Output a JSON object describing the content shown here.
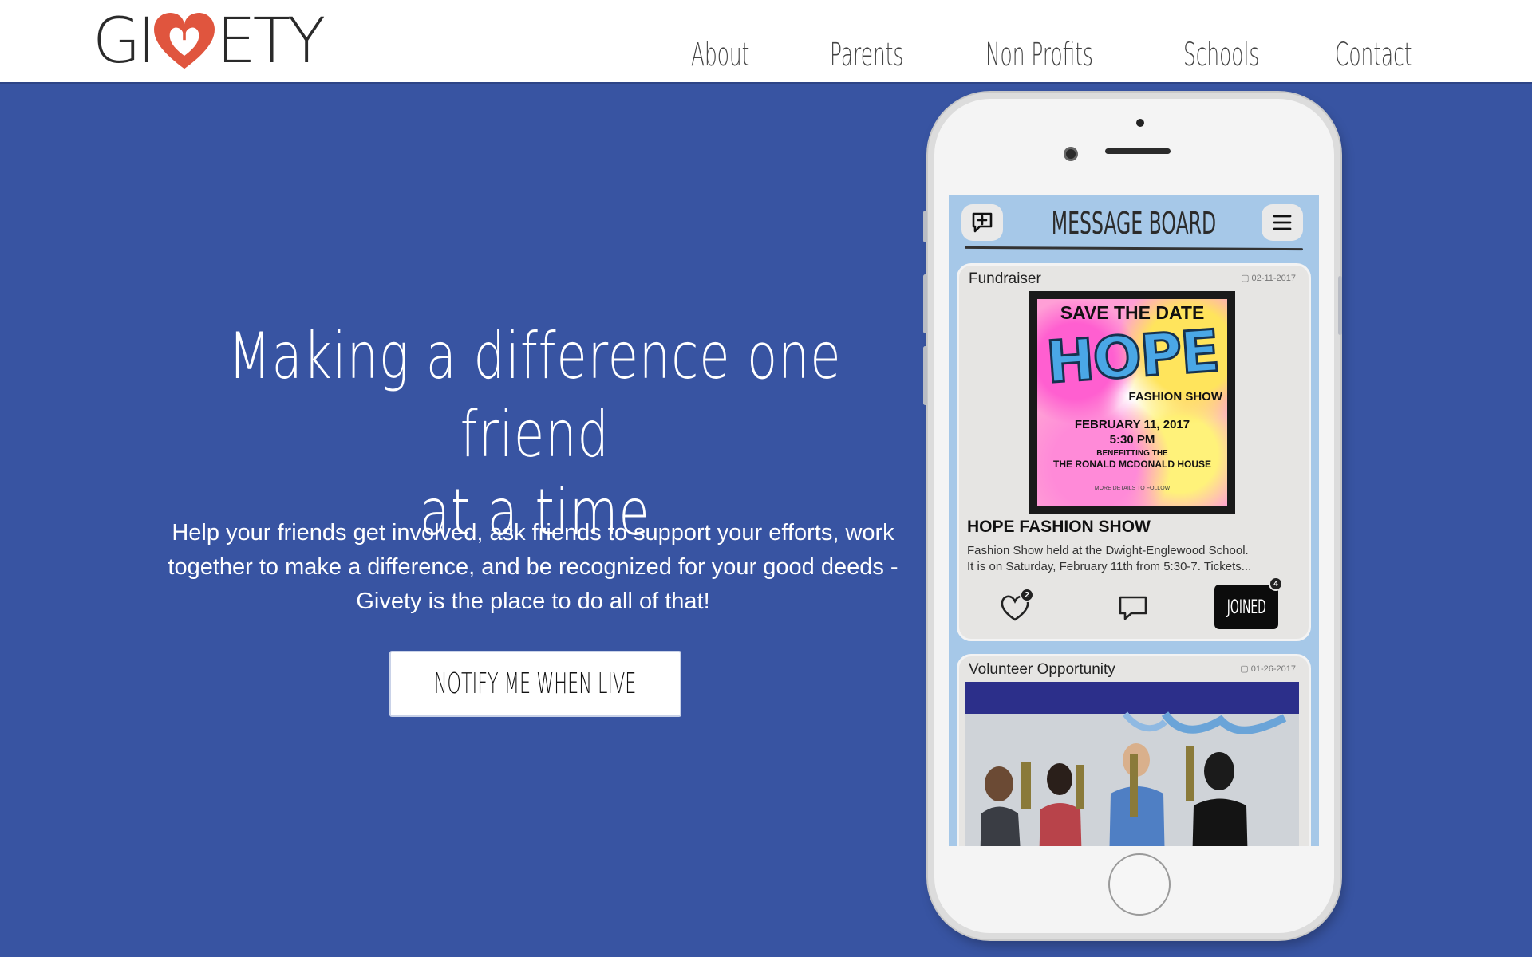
{
  "header": {
    "logo_left": "GI",
    "logo_right": "ETY",
    "nav": [
      "About",
      "Parents",
      "Non Profits",
      "Schools",
      "Contact"
    ]
  },
  "hero": {
    "title_line1": "Making a difference one friend",
    "title_line2": "at a time",
    "body_line1": "Help your friends get involved, ask friends to support your efforts, work",
    "body_line2": "together to make a difference, and be recognized for your good deeds -",
    "body_line3": "Givety is the place to do all of that!",
    "cta_label": "NOTIFY ME WHEN LIVE"
  },
  "app": {
    "title": "MESSAGE BOARD",
    "left_icon": "add-message-icon",
    "right_icon": "menu-icon",
    "posts": [
      {
        "category": "Fundraiser",
        "date": "02-11-2017",
        "poster": {
          "line1": "SAVE THE DATE",
          "line2": "HOPE",
          "line3": "FASHION SHOW",
          "line4": "FEBRUARY 11, 2017",
          "line5": "5:30 PM",
          "line6": "BENEFITTING THE",
          "line7": "THE RONALD MCDONALD HOUSE",
          "line8": "MORE DETAILS TO FOLLOW"
        },
        "title": "HOPE FASHION SHOW",
        "desc_line1": "Fashion Show held at the Dwight-Englewood School.",
        "desc_line2": "It is on Saturday, February 11th from 5:30-7. Tickets...",
        "likes": "2",
        "joined_label": "JOINED",
        "joined_count": "4"
      },
      {
        "category": "Volunteer Opportunity",
        "date": "01-26-2017"
      }
    ]
  },
  "colors": {
    "background": "#3854a2",
    "accent_heart": "#e0553e",
    "screen_blue": "#a6c8e8"
  }
}
